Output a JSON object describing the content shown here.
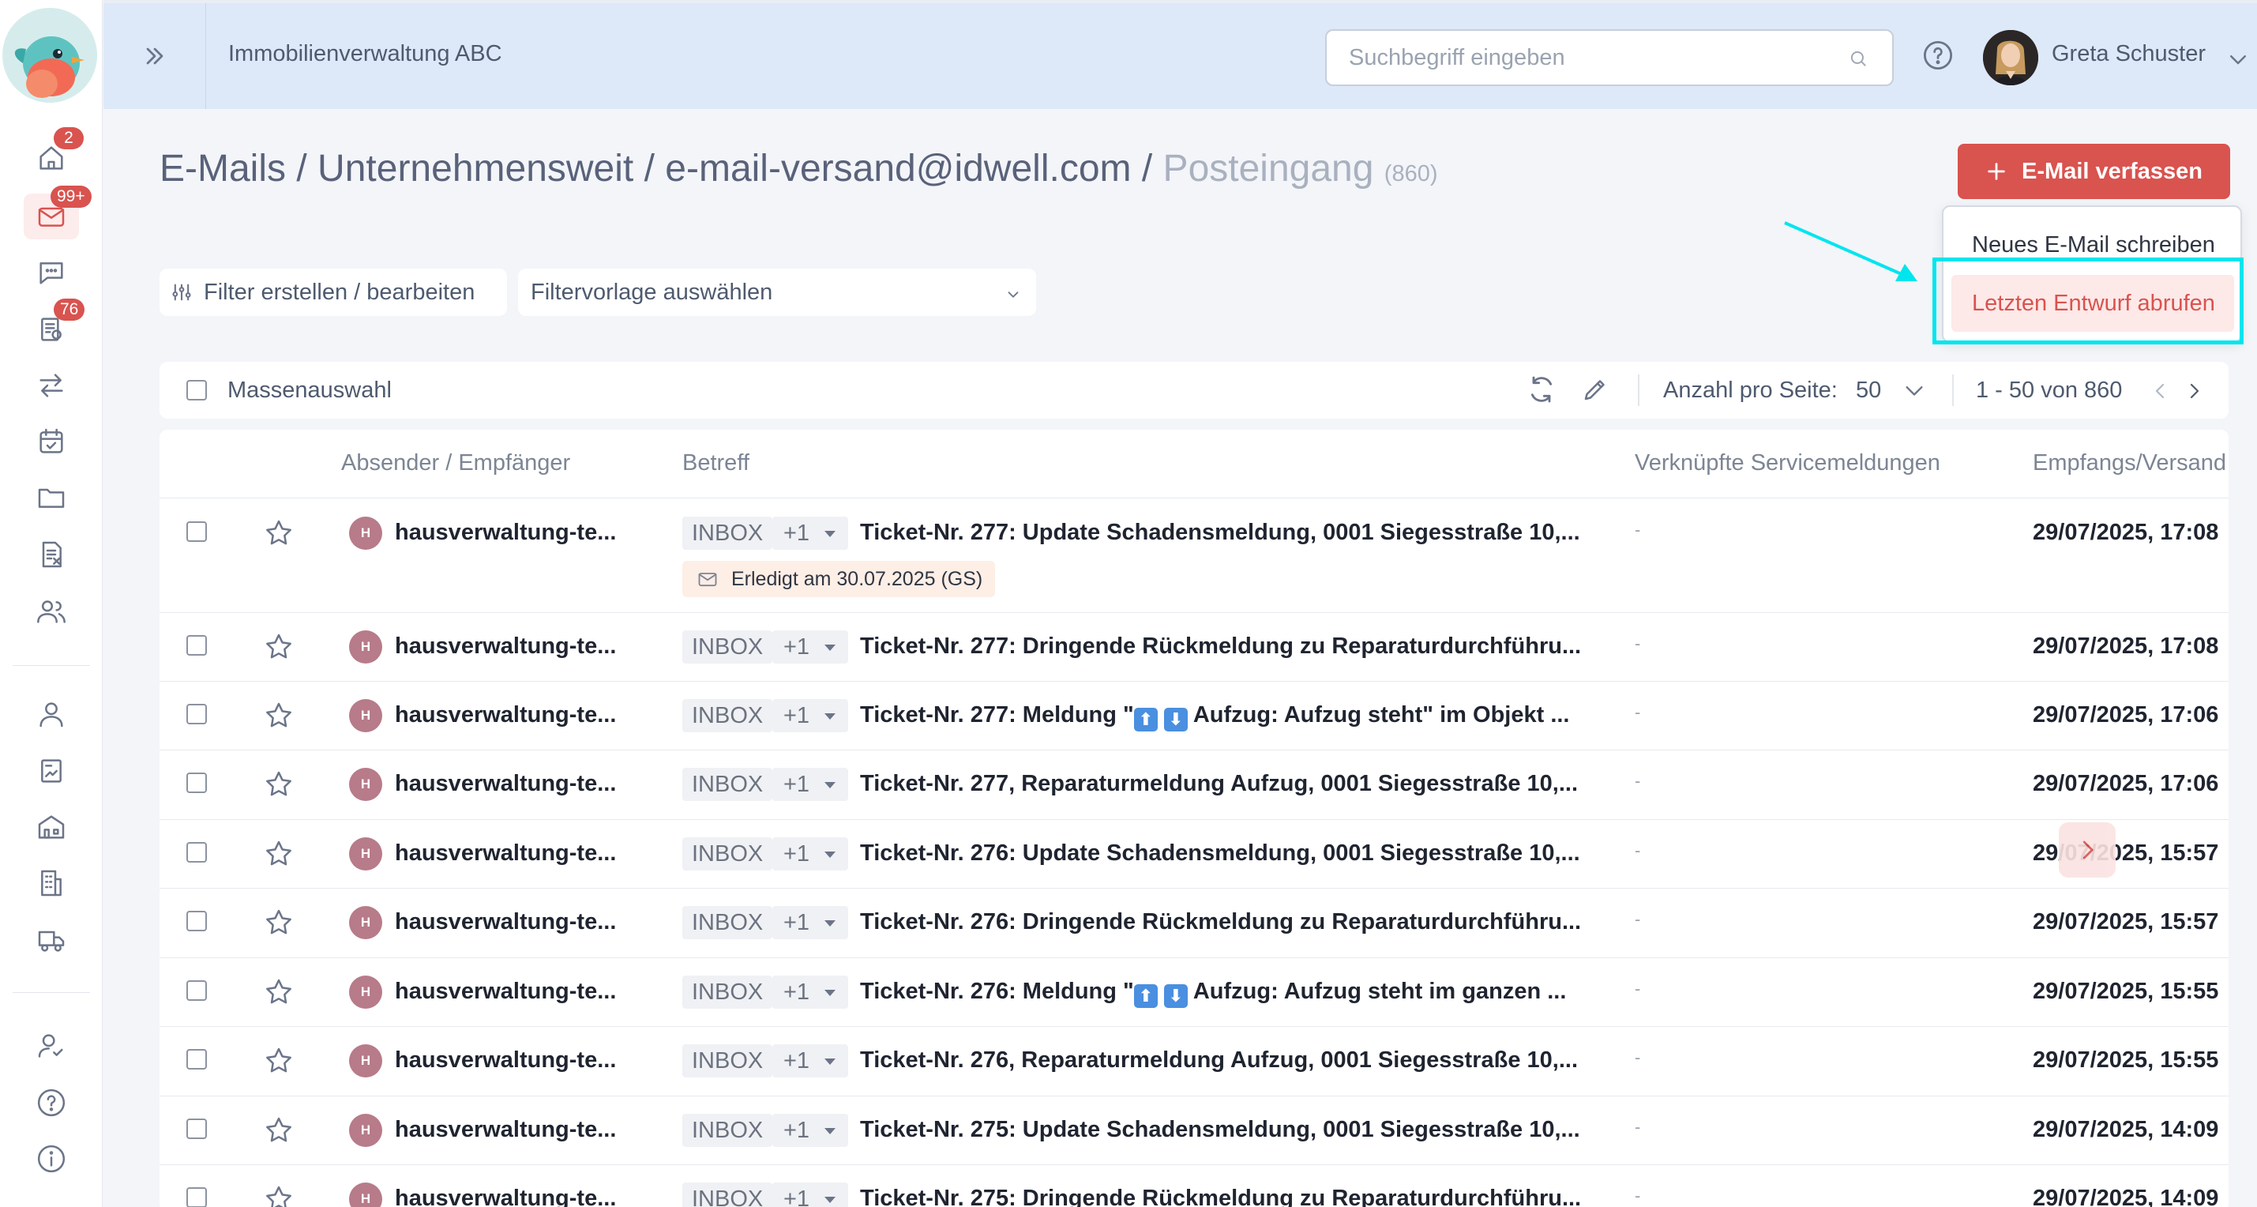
{
  "app": {
    "company": "Immobilienverwaltung ABC",
    "accent_color": "#d9534f",
    "header_bg": "#dde9f8"
  },
  "search": {
    "placeholder": "Suchbegriff eingeben"
  },
  "user": {
    "name": "Greta Schuster"
  },
  "sidebar": {
    "items": [
      {
        "icon": "home-icon",
        "badge": "2"
      },
      {
        "icon": "mail-icon",
        "badge": "99+",
        "active": true
      },
      {
        "icon": "chat-icon"
      },
      {
        "icon": "ticket-icon",
        "badge": "76"
      },
      {
        "icon": "transfer-icon"
      },
      {
        "icon": "calendar-check-icon"
      },
      {
        "icon": "folder-icon"
      },
      {
        "icon": "invoice-icon"
      },
      {
        "icon": "users-icon"
      },
      {
        "icon": "person-icon"
      },
      {
        "icon": "contract-icon"
      },
      {
        "icon": "property-icon"
      },
      {
        "icon": "building-icon"
      },
      {
        "icon": "truck-icon"
      },
      {
        "icon": "user-check-icon"
      },
      {
        "icon": "help-icon"
      },
      {
        "icon": "info-icon"
      }
    ]
  },
  "breadcrumb": {
    "part1": "E-Mails",
    "sep": "/",
    "part2": "Unternehmensweit",
    "part3": "e-mail-versand@idwell.com",
    "current": "Posteingang",
    "count": "(860)"
  },
  "compose": {
    "label": "E-Mail verfassen",
    "menu_new": "Neues E-Mail schreiben",
    "menu_draft": "Letzten Entwurf abrufen"
  },
  "filters": {
    "edit_label": "Filter erstellen / bearbeiten",
    "template_label": "Filtervorlage auswählen"
  },
  "toolbar": {
    "mass_select": "Massenauswahl",
    "per_page_label": "Anzahl pro Seite:",
    "per_page_value": "50",
    "range": "1 - 50 von 860"
  },
  "table": {
    "headers": {
      "sender": "Absender / Empfänger",
      "subject": "Betreff",
      "services": "Verknüpfte Servicemeldungen",
      "date": "Empfangs/Versand"
    },
    "rows": [
      {
        "avatar": "H",
        "sender": "hausverwaltung-te...",
        "inbox": "INBOX",
        "more": "+1",
        "subject_a": "Ticket-Nr. 277: Update Schadensmeldung, 0001 Siegesstraße 10,...",
        "svc": "-",
        "date": "29/07/2025, 17:08",
        "status": "Erledigt am 30.07.2025 (GS)"
      },
      {
        "avatar": "H",
        "sender": "hausverwaltung-te...",
        "inbox": "INBOX",
        "more": "+1",
        "subject_a": "Ticket-Nr. 277: Dringende Rückmeldung zu Reparaturdurchführu...",
        "svc": "-",
        "date": "29/07/2025, 17:08"
      },
      {
        "avatar": "H",
        "sender": "hausverwaltung-te...",
        "inbox": "INBOX",
        "more": "+1",
        "subject_a": "Ticket-Nr. 277: Meldung \"",
        "emoji1": "⬆",
        "emoji2": "⬇",
        "subject_b": " Aufzug: Aufzug steht\" im Objekt ...",
        "svc": "-",
        "date": "29/07/2025, 17:06"
      },
      {
        "avatar": "H",
        "sender": "hausverwaltung-te...",
        "inbox": "INBOX",
        "more": "+1",
        "subject_a": "Ticket-Nr. 277, Reparaturmeldung Aufzug, 0001 Siegesstraße 10,...",
        "svc": "-",
        "date": "29/07/2025, 17:06"
      },
      {
        "avatar": "H",
        "sender": "hausverwaltung-te...",
        "inbox": "INBOX",
        "more": "+1",
        "subject_a": "Ticket-Nr. 276: Update Schadensmeldung, 0001 Siegesstraße 10,...",
        "svc": "-",
        "date": "29/07/2025, 15:57"
      },
      {
        "avatar": "H",
        "sender": "hausverwaltung-te...",
        "inbox": "INBOX",
        "more": "+1",
        "subject_a": "Ticket-Nr. 276: Dringende Rückmeldung zu Reparaturdurchführu...",
        "svc": "-",
        "date": "29/07/2025, 15:57"
      },
      {
        "avatar": "H",
        "sender": "hausverwaltung-te...",
        "inbox": "INBOX",
        "more": "+1",
        "subject_a": "Ticket-Nr. 276: Meldung \"",
        "emoji1": "⬆",
        "emoji2": "⬇",
        "subject_b": " Aufzug: Aufzug steht im ganzen ...",
        "svc": "-",
        "date": "29/07/2025, 15:55"
      },
      {
        "avatar": "H",
        "sender": "hausverwaltung-te...",
        "inbox": "INBOX",
        "more": "+1",
        "subject_a": "Ticket-Nr. 276, Reparaturmeldung Aufzug, 0001 Siegesstraße 10,...",
        "svc": "-",
        "date": "29/07/2025, 15:55"
      },
      {
        "avatar": "H",
        "sender": "hausverwaltung-te...",
        "inbox": "INBOX",
        "more": "+1",
        "subject_a": "Ticket-Nr. 275: Update Schadensmeldung, 0001 Siegesstraße 10,...",
        "svc": "-",
        "date": "29/07/2025, 14:09"
      },
      {
        "avatar": "H",
        "sender": "hausverwaltung-te...",
        "inbox": "INBOX",
        "more": "+1",
        "subject_a": "Ticket-Nr. 275: Dringende Rückmeldung zu Reparaturdurchführu...",
        "svc": "-",
        "date": "29/07/2025, 14:09"
      }
    ]
  }
}
